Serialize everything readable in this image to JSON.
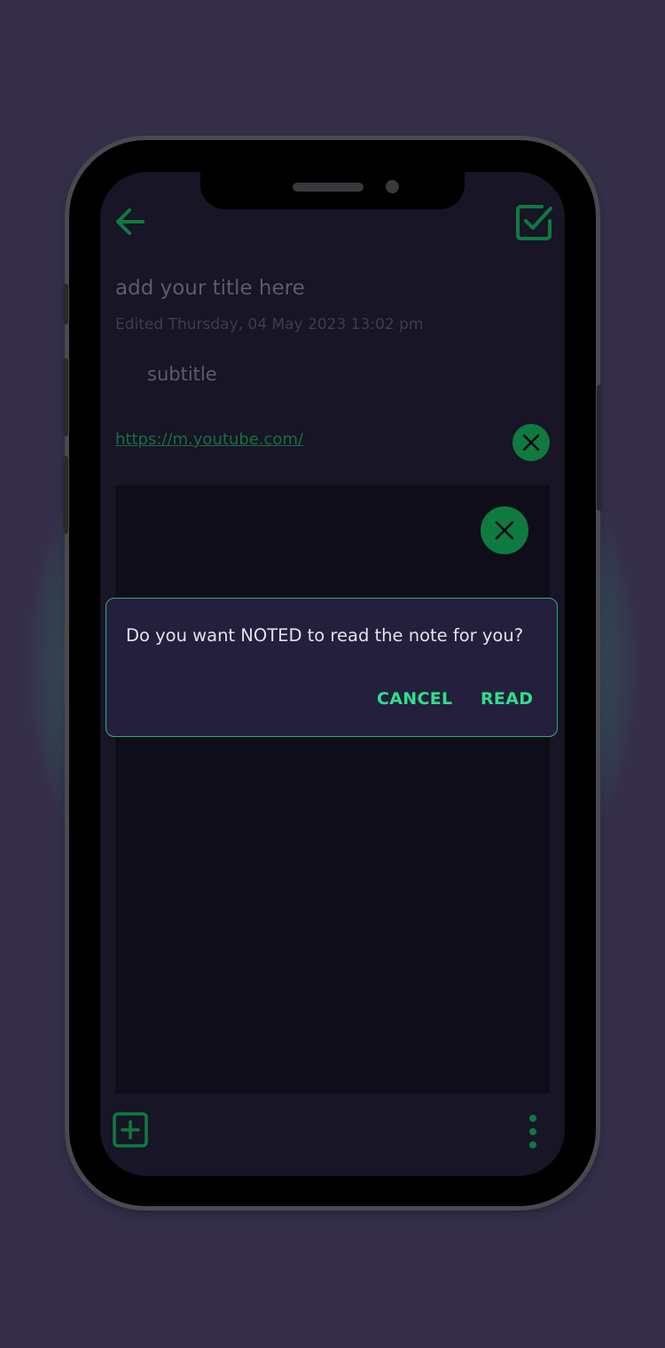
{
  "note": {
    "title_placeholder": "add your title here",
    "edited_label": "Edited Thursday, 04 May 2023 13:02 pm",
    "subtitle": "subtitle",
    "link": "https://m.youtube.com/"
  },
  "dialog": {
    "message": "Do you want NOTED to read the note for you?",
    "cancel_label": "CANCEL",
    "read_label": "READ"
  },
  "icons": {
    "back": "arrow-left-icon",
    "save": "checkbox-check-icon",
    "remove_link": "close-icon",
    "remove_media": "close-icon",
    "add": "plus-square-icon",
    "more": "more-vertical-icon"
  },
  "colors": {
    "accent": "#0f7a3f",
    "dialog_accent": "#2ee08a",
    "background": "#352f4a",
    "screen": "#171526"
  }
}
